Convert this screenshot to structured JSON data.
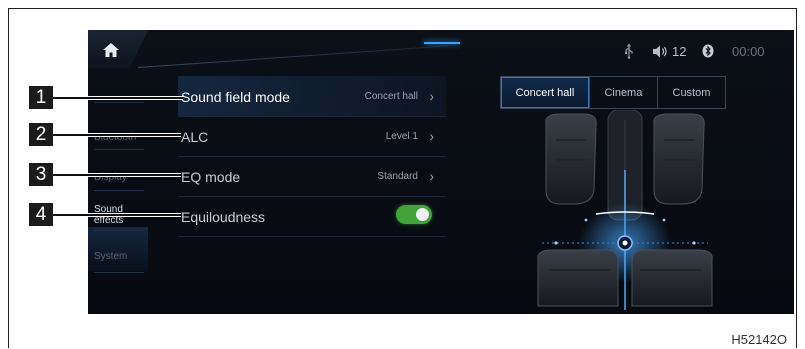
{
  "header": {
    "volume_value": "12",
    "clock": "00:00"
  },
  "sidebar": {
    "items": [
      {
        "label": "Bluetooth"
      },
      {
        "label": "Display"
      },
      {
        "label": "Sound\neffects"
      },
      {
        "label": "System"
      }
    ]
  },
  "settings": {
    "rows": [
      {
        "label": "Sound field mode",
        "value": "Concert hall",
        "chevron": "›"
      },
      {
        "label": "ALC",
        "value": "Level 1",
        "chevron": "›"
      },
      {
        "label": "EQ mode",
        "value": "Standard",
        "chevron": "›"
      },
      {
        "label": "Equiloudness",
        "toggle": "on"
      }
    ]
  },
  "sound_field_tabs": [
    {
      "label": "Concert hall",
      "active": true
    },
    {
      "label": "Cinema",
      "active": false
    },
    {
      "label": "Custom",
      "active": false
    }
  ],
  "callouts": [
    "1",
    "2",
    "3",
    "4"
  ],
  "reference_code": "H52142O",
  "colors": {
    "accent_blue": "#3aa3ff",
    "toggle_green": "#43a33b",
    "screen_bg": "#0b0f16"
  },
  "icons": [
    "home-icon",
    "usb-icon",
    "volume-icon",
    "bluetooth-icon",
    "chevron-right-icon"
  ]
}
